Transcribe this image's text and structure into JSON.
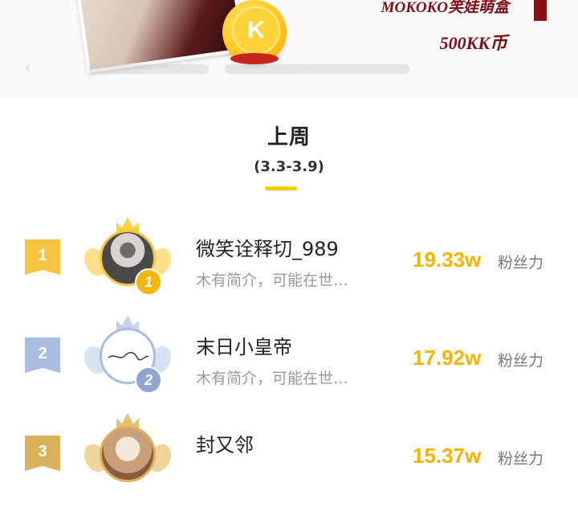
{
  "banner": {
    "coin_letter": "K",
    "promo_title": "MOKOKO笑娃萌盒",
    "promo_price": "500KK币"
  },
  "week": {
    "title": "上周",
    "range": "(3.3-3.9)"
  },
  "fans_unit": "粉丝力",
  "ranking": [
    {
      "rank": "1",
      "name": "微笑诠释切_989",
      "bio": "木有简介，可能在世…",
      "fans": "19.33w"
    },
    {
      "rank": "2",
      "name": "末日小皇帝",
      "bio": "木有简介，可能在世…",
      "fans": "17.92w"
    },
    {
      "rank": "3",
      "name": "封又邻",
      "bio": "",
      "fans": "15.37w"
    }
  ],
  "colors": {
    "accent": "#ffcc00",
    "fans_value": "#f4b400",
    "gold": "#f5c542",
    "silver": "#9fb3d6",
    "bronze": "#d9b15a",
    "promo_red": "#7e0d14"
  }
}
